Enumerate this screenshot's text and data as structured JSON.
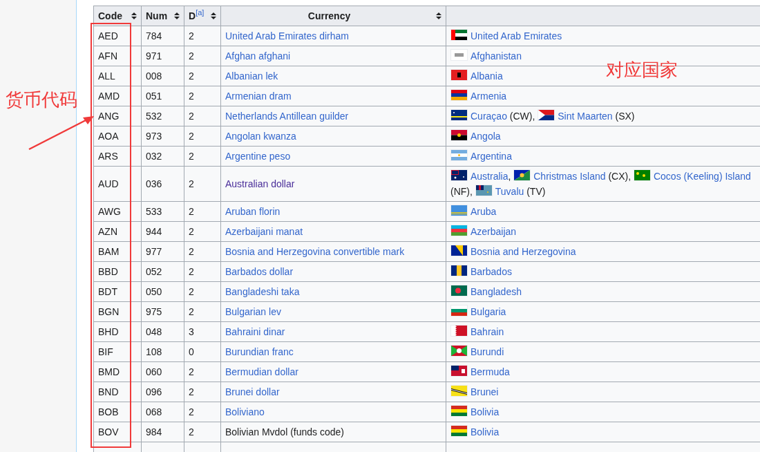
{
  "table": {
    "columns": [
      {
        "label": "Code"
      },
      {
        "label": "Num"
      },
      {
        "label": "D",
        "note": "[a]"
      },
      {
        "label": "Currency"
      }
    ],
    "rows": [
      {
        "code": "AED",
        "num": "784",
        "d": "2",
        "currency": {
          "text": "United Arab Emirates dirham",
          "kind": "link"
        },
        "lines": [
          [
            {
              "kind": "ae",
              "name": "United Arab Emirates"
            }
          ]
        ]
      },
      {
        "code": "AFN",
        "num": "971",
        "d": "2",
        "currency": {
          "text": "Afghan afghani",
          "kind": "link"
        },
        "lines": [
          [
            {
              "kind": "af",
              "name": "Afghanistan"
            }
          ]
        ]
      },
      {
        "code": "ALL",
        "num": "008",
        "d": "2",
        "currency": {
          "text": "Albanian lek",
          "kind": "link"
        },
        "lines": [
          [
            {
              "kind": "al",
              "name": "Albania"
            }
          ]
        ]
      },
      {
        "code": "AMD",
        "num": "051",
        "d": "2",
        "currency": {
          "text": "Armenian dram",
          "kind": "link"
        },
        "lines": [
          [
            {
              "kind": "am",
              "name": "Armenia"
            }
          ]
        ]
      },
      {
        "code": "ANG",
        "num": "532",
        "d": "2",
        "currency": {
          "text": "Netherlands Antillean guilder",
          "kind": "link"
        },
        "lines": [
          [
            {
              "kind": "cw",
              "name": "Curaçao",
              "code": "(CW),"
            },
            {
              "kind": "sx",
              "name": "Sint Maarten",
              "code": "(SX)"
            }
          ]
        ]
      },
      {
        "code": "AOA",
        "num": "973",
        "d": "2",
        "currency": {
          "text": "Angolan kwanza",
          "kind": "link"
        },
        "lines": [
          [
            {
              "kind": "ao",
              "name": "Angola"
            }
          ]
        ]
      },
      {
        "code": "ARS",
        "num": "032",
        "d": "2",
        "currency": {
          "text": "Argentine peso",
          "kind": "link"
        },
        "lines": [
          [
            {
              "kind": "ar",
              "name": "Argentina"
            }
          ]
        ]
      },
      {
        "code": "AUD",
        "num": "036",
        "d": "2",
        "currency": {
          "text": "Australian dollar",
          "kind": "visited"
        },
        "lines": [
          [
            {
              "kind": "au",
              "name": "Australia",
              "sep": ","
            },
            {
              "kind": "cx",
              "name": "Christmas Island",
              "code": "(CX),"
            },
            {
              "kind": "cc",
              "name": "Cocos (Keeling) Island"
            }
          ],
          [
            {
              "code": "(NF),"
            },
            {
              "kind": "tv",
              "name": "Tuvalu",
              "code": "(TV)"
            }
          ]
        ]
      },
      {
        "code": "AWG",
        "num": "533",
        "d": "2",
        "currency": {
          "text": "Aruban florin",
          "kind": "link"
        },
        "lines": [
          [
            {
              "kind": "aw",
              "name": "Aruba"
            }
          ]
        ]
      },
      {
        "code": "AZN",
        "num": "944",
        "d": "2",
        "currency": {
          "text": "Azerbaijani manat",
          "kind": "link"
        },
        "lines": [
          [
            {
              "kind": "az",
              "name": "Azerbaijan"
            }
          ]
        ]
      },
      {
        "code": "BAM",
        "num": "977",
        "d": "2",
        "currency": {
          "text": "Bosnia and Herzegovina convertible mark",
          "kind": "link"
        },
        "lines": [
          [
            {
              "kind": "ba",
              "name": "Bosnia and Herzegovina"
            }
          ]
        ]
      },
      {
        "code": "BBD",
        "num": "052",
        "d": "2",
        "currency": {
          "text": "Barbados dollar",
          "kind": "link"
        },
        "lines": [
          [
            {
              "kind": "bb",
              "name": "Barbados"
            }
          ]
        ]
      },
      {
        "code": "BDT",
        "num": "050",
        "d": "2",
        "currency": {
          "text": "Bangladeshi taka",
          "kind": "link"
        },
        "lines": [
          [
            {
              "kind": "bd",
              "name": "Bangladesh"
            }
          ]
        ]
      },
      {
        "code": "BGN",
        "num": "975",
        "d": "2",
        "currency": {
          "text": "Bulgarian lev",
          "kind": "link"
        },
        "lines": [
          [
            {
              "kind": "bg",
              "name": "Bulgaria"
            }
          ]
        ]
      },
      {
        "code": "BHD",
        "num": "048",
        "d": "3",
        "currency": {
          "text": "Bahraini dinar",
          "kind": "link"
        },
        "lines": [
          [
            {
              "kind": "bh",
              "name": "Bahrain"
            }
          ]
        ]
      },
      {
        "code": "BIF",
        "num": "108",
        "d": "0",
        "currency": {
          "text": "Burundian franc",
          "kind": "link"
        },
        "lines": [
          [
            {
              "kind": "bi",
              "name": "Burundi"
            }
          ]
        ]
      },
      {
        "code": "BMD",
        "num": "060",
        "d": "2",
        "currency": {
          "text": "Bermudian dollar",
          "kind": "link"
        },
        "lines": [
          [
            {
              "kind": "bm",
              "name": "Bermuda"
            }
          ]
        ]
      },
      {
        "code": "BND",
        "num": "096",
        "d": "2",
        "currency": {
          "text": "Brunei dollar",
          "kind": "link"
        },
        "lines": [
          [
            {
              "kind": "bn",
              "name": "Brunei"
            }
          ]
        ]
      },
      {
        "code": "BOB",
        "num": "068",
        "d": "2",
        "currency": {
          "text": "Boliviano",
          "kind": "link"
        },
        "lines": [
          [
            {
              "kind": "bo",
              "name": "Bolivia"
            }
          ]
        ]
      },
      {
        "code": "BOV",
        "num": "984",
        "d": "2",
        "currency": {
          "text": "Bolivian Mvdol (funds code)",
          "kind": "plain"
        },
        "lines": [
          [
            {
              "kind": "bo",
              "name": "Bolivia"
            }
          ]
        ]
      }
    ]
  },
  "annotations": [
    {
      "kind": "box"
    },
    {
      "kind": "label",
      "text": "货币代码"
    },
    {
      "kind": "arrow"
    },
    {
      "kind": "label",
      "text": "对应国家"
    }
  ]
}
